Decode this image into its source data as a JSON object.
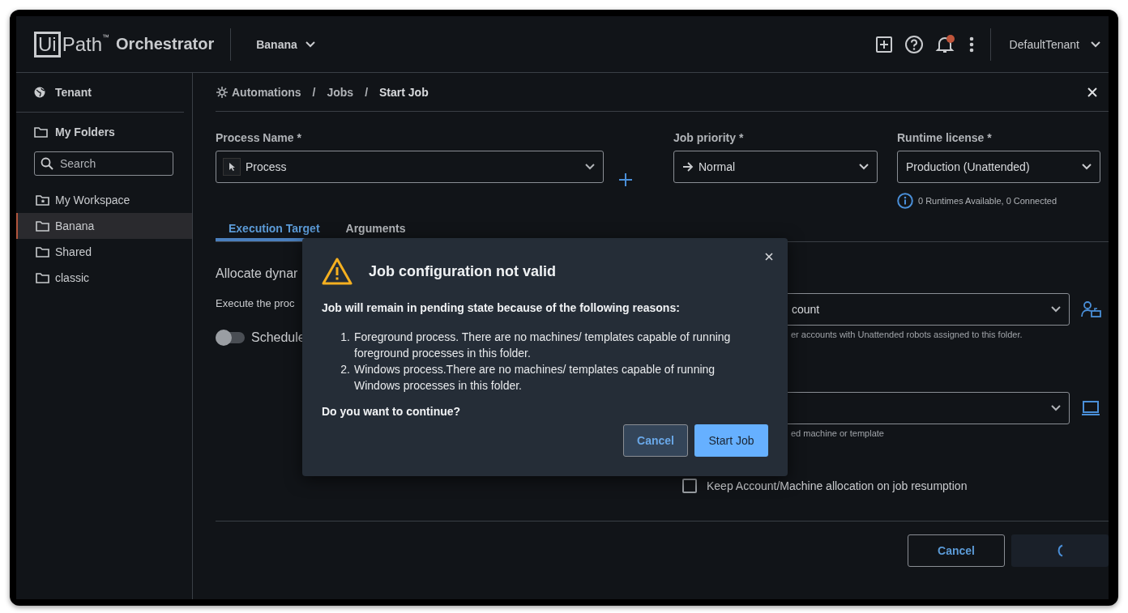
{
  "header": {
    "logo": {
      "box": "Ui",
      "word": "Path",
      "mark": "™",
      "product": "Orchestrator"
    },
    "folder_picker": "Banana",
    "notifications": {
      "unread": true
    },
    "tenant": "DefaultTenant"
  },
  "sidebar": {
    "tenant": "Tenant",
    "section": "My Folders",
    "search": {
      "placeholder": "Search"
    },
    "items": [
      {
        "label": "My Workspace",
        "kind": "workspace",
        "selected": false
      },
      {
        "label": "Banana",
        "kind": "folder",
        "selected": true
      },
      {
        "label": "Shared",
        "kind": "folder",
        "selected": false
      },
      {
        "label": "classic",
        "kind": "folder",
        "selected": false
      }
    ]
  },
  "breadcrumb": {
    "separator": "/",
    "items": [
      "Automations",
      "Jobs",
      "Start Job"
    ]
  },
  "form": {
    "process": {
      "label": "Process Name *",
      "value": "Process"
    },
    "priority": {
      "label": "Job priority *",
      "value": "Normal"
    },
    "license": {
      "label": "Runtime license *",
      "value": "Production (Unattended)",
      "info": "0 Runtimes Available, 0 Connected"
    }
  },
  "tabs": [
    {
      "label": "Execution Target",
      "selected": true
    },
    {
      "label": "Arguments",
      "selected": false
    }
  ],
  "execution": {
    "heading": "Allocate dynar",
    "description": "Execute the proc",
    "schedule": {
      "label": "Schedule",
      "on": false
    },
    "account": {
      "value": "count",
      "hint": "er accounts with Unattended robots assigned to this folder."
    },
    "machine": {
      "hint": "ed machine or template"
    },
    "keep_allocation": {
      "label": "Keep Account/Machine allocation on job resumption",
      "checked": false
    }
  },
  "footer": {
    "cancel": "Cancel",
    "start": {
      "loading": true
    }
  },
  "dialog": {
    "title": "Job configuration not valid",
    "intro": "Job will remain in pending state because of the following reasons:",
    "reasons": [
      {
        "number": "1.",
        "text": "Foreground process. There are no machines/ templates capable of running foreground processes in this folder."
      },
      {
        "number": "2.",
        "text": "Windows process.There are no machines/ templates capable of running Windows processes in this folder."
      }
    ],
    "question": "Do you want to continue?",
    "buttons": [
      {
        "label": "Cancel",
        "kind": "secondary"
      },
      {
        "label": "Start Job",
        "kind": "primary"
      }
    ]
  }
}
